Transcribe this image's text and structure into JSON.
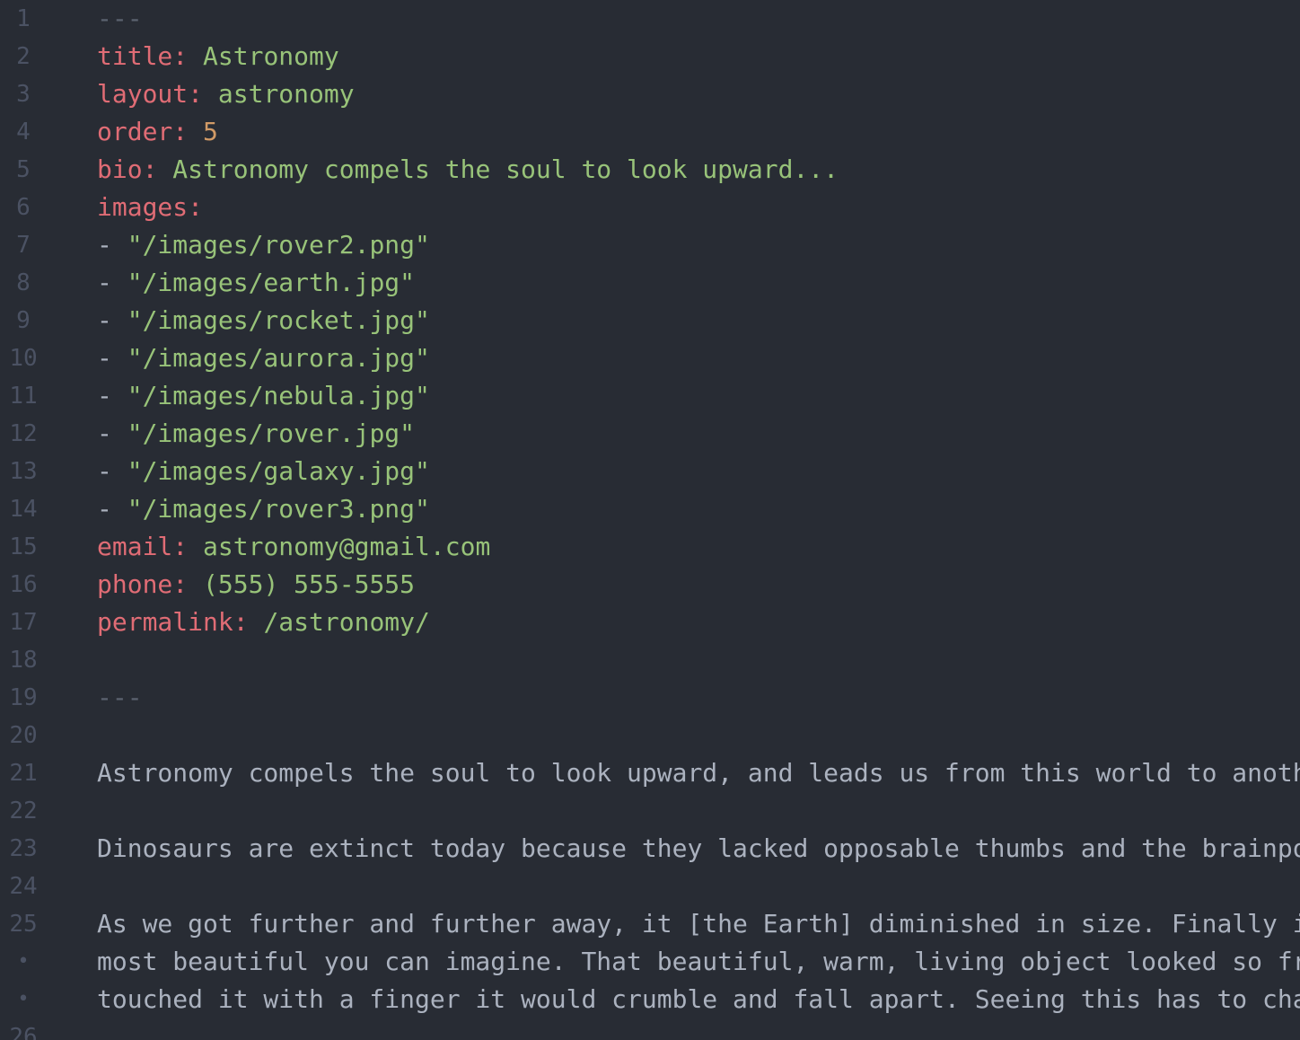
{
  "editor": {
    "colors": {
      "background": "#282c34",
      "gutter": "#4b5263",
      "key": "#e06c75",
      "string": "#98c379",
      "number": "#d19a66",
      "text": "#abb2bf",
      "separator": "#5c6370"
    },
    "lines": [
      {
        "num": "1",
        "sep": "---"
      },
      {
        "num": "2",
        "key": "title:",
        "val": "Astronomy"
      },
      {
        "num": "3",
        "key": "layout:",
        "val": "astronomy"
      },
      {
        "num": "4",
        "key": "order:",
        "num_val": "5"
      },
      {
        "num": "5",
        "key": "bio:",
        "val": "Astronomy compels the soul to look upward..."
      },
      {
        "num": "6",
        "key": "images:"
      },
      {
        "num": "7",
        "dash": "-",
        "val": "\"/images/rover2.png\""
      },
      {
        "num": "8",
        "dash": "-",
        "val": "\"/images/earth.jpg\""
      },
      {
        "num": "9",
        "dash": "-",
        "val": "\"/images/rocket.jpg\""
      },
      {
        "num": "10",
        "dash": "-",
        "val": "\"/images/aurora.jpg\""
      },
      {
        "num": "11",
        "dash": "-",
        "val": "\"/images/nebula.jpg\""
      },
      {
        "num": "12",
        "dash": "-",
        "val": "\"/images/rover.jpg\""
      },
      {
        "num": "13",
        "dash": "-",
        "val": "\"/images/galaxy.jpg\""
      },
      {
        "num": "14",
        "dash": "-",
        "val": "\"/images/rover3.png\""
      },
      {
        "num": "15",
        "key": "email:",
        "val": "astronomy@gmail.com"
      },
      {
        "num": "16",
        "key": "phone:",
        "val": "(555) 555-5555"
      },
      {
        "num": "17",
        "key": "permalink:",
        "val": "/astronomy/"
      },
      {
        "num": "18"
      },
      {
        "num": "19",
        "sep": "---"
      },
      {
        "num": "20"
      },
      {
        "num": "21",
        "text": "Astronomy compels the soul to look upward, and leads us from this world to anoth"
      },
      {
        "num": "22"
      },
      {
        "num": "23",
        "text": "Dinosaurs are extinct today because they lacked opposable thumbs and the brainpo"
      },
      {
        "num": "24"
      },
      {
        "num": "25",
        "text": "As we got further and further away, it [the Earth] diminished in size. Finally i"
      },
      {
        "num": "•",
        "text": "most beautiful you can imagine. That beautiful, warm, living object looked so fr"
      },
      {
        "num": "•",
        "text": "touched it with a finger it would crumble and fall apart. Seeing this has to cha"
      },
      {
        "num": "26"
      }
    ]
  }
}
